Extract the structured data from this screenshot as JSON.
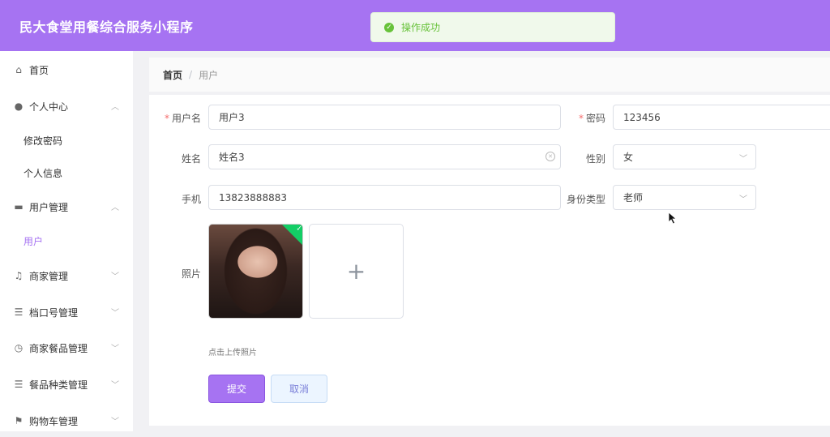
{
  "header": {
    "title": "民大食堂用餐综合服务小程序"
  },
  "toast": {
    "message": "操作成功"
  },
  "sidebar": {
    "items": [
      {
        "label": "首页",
        "icon": "home-icon"
      },
      {
        "label": "个人中心",
        "icon": "user-icon",
        "expanded": true,
        "children": [
          "修改密码",
          "个人信息"
        ]
      },
      {
        "label": "用户管理",
        "icon": "briefcase-icon",
        "expanded": true,
        "children": [
          "用户"
        ]
      },
      {
        "label": "商家管理",
        "icon": "bell-icon"
      },
      {
        "label": "档口号管理",
        "icon": "list-icon"
      },
      {
        "label": "商家餐品管理",
        "icon": "compass-icon"
      },
      {
        "label": "餐品种类管理",
        "icon": "list-icon"
      },
      {
        "label": "购物车管理",
        "icon": "flag-icon"
      }
    ],
    "active": "用户"
  },
  "breadcrumb": {
    "home": "首页",
    "separator": "/",
    "current": "用户"
  },
  "form": {
    "username": {
      "label": "用户名",
      "value": "用户3"
    },
    "password": {
      "label": "密码",
      "value": "123456"
    },
    "name": {
      "label": "姓名",
      "value": "姓名3"
    },
    "gender": {
      "label": "性别",
      "value": "女"
    },
    "phone": {
      "label": "手机",
      "value": "13823888883"
    },
    "identity": {
      "label": "身份类型",
      "value": "老师"
    },
    "photo": {
      "label": "照片",
      "hint": "点击上传照片",
      "add_symbol": "+"
    },
    "submit_label": "提交",
    "cancel_label": "取消"
  },
  "colors": {
    "primary": "#a673f2",
    "success": "#67c23a",
    "required": "#f56c6c"
  }
}
